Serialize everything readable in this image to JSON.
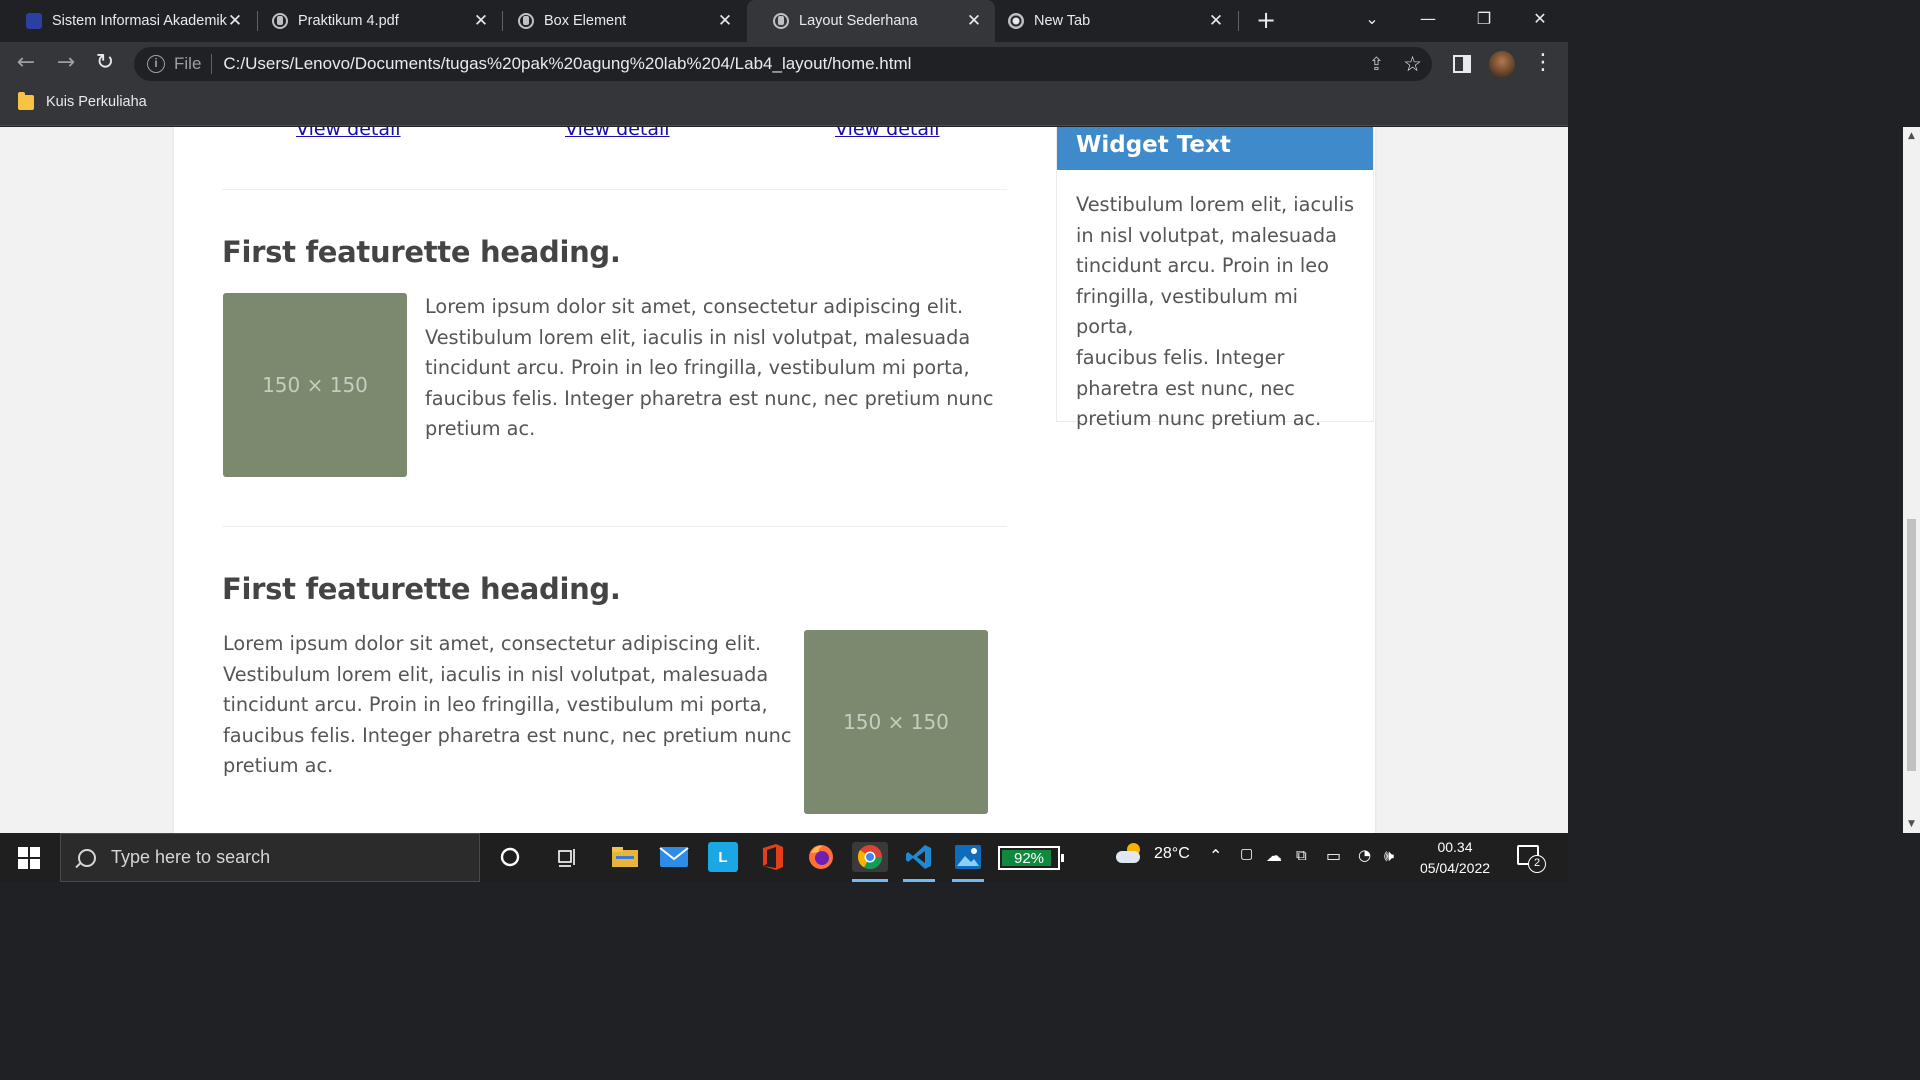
{
  "browser": {
    "tabs": [
      {
        "title": "Sistem Informasi Akademik",
        "icon": "university-icon",
        "active": false
      },
      {
        "title": "Praktikum 4.pdf",
        "icon": "globe-icon",
        "active": false
      },
      {
        "title": "Box Element",
        "icon": "globe-icon",
        "active": false
      },
      {
        "title": "Layout Sederhana",
        "icon": "globe-icon",
        "active": true
      },
      {
        "title": "New Tab",
        "icon": "chrome-icon",
        "active": false
      }
    ],
    "new_tab_glyph": "+",
    "close_glyph": "✕",
    "window_controls": {
      "minimize": "—",
      "restore": "❐",
      "close": "✕",
      "tab_search": "⌄"
    },
    "address": {
      "scheme_label": "File",
      "url": "C:/Users/Lenovo/Documents/tugas%20pak%20agung%20lab%204/Lab4_layout/home.html"
    },
    "bookmarks": [
      {
        "label": "Kuis Perkuliaha",
        "icon": "folder-icon"
      }
    ]
  },
  "page": {
    "links": [
      "View detail",
      "View detail",
      "View detail"
    ],
    "featurettes": [
      {
        "heading": "First featurette heading.",
        "image_label": "150 × 150",
        "text_lines": [
          "Lorem ipsum dolor sit amet, consectetur adipiscing elit.",
          "Vestibulum lorem elit, iaculis in nisl volutpat, malesuada",
          "tincidunt arcu. Proin in leo fringilla, vestibulum mi porta,",
          "faucibus felis. Integer pharetra est nunc, nec pretium nunc",
          "pretium ac."
        ]
      },
      {
        "heading": "First featurette heading.",
        "image_label": "150 × 150",
        "text_lines": [
          "Lorem ipsum dolor sit amet, consectetur adipiscing elit.",
          "Vestibulum lorem elit, iaculis in nisl volutpat, malesuada",
          "tincidunt arcu. Proin in leo fringilla, vestibulum mi porta,",
          "faucibus felis. Integer pharetra est nunc, nec pretium nunc",
          "pretium ac."
        ]
      }
    ],
    "widget": {
      "title": "Widget Text",
      "lines": [
        "Vestibulum lorem elit, iaculis",
        "in nisl volutpat, malesuada",
        "tincidunt arcu. Proin in leo",
        "fringilla, vestibulum mi porta,",
        "faucibus felis. Integer",
        "pharetra est nunc, nec",
        "pretium nunc pretium ac."
      ]
    },
    "colors": {
      "widget_header": "#3f8acb",
      "placeholder": "#7b8a6f",
      "link": "#1a0dab"
    }
  },
  "taskbar": {
    "search_placeholder": "Type here to search",
    "battery_percent": "92%",
    "battery_level": 0.92,
    "temperature": "28°C",
    "time": "00.34",
    "date": "05/04/2022",
    "notification_count": "2",
    "apps": [
      "cortana",
      "task-view",
      "file-explorer",
      "mail",
      "lms",
      "office",
      "firefox",
      "chrome",
      "vscode",
      "photos"
    ]
  }
}
